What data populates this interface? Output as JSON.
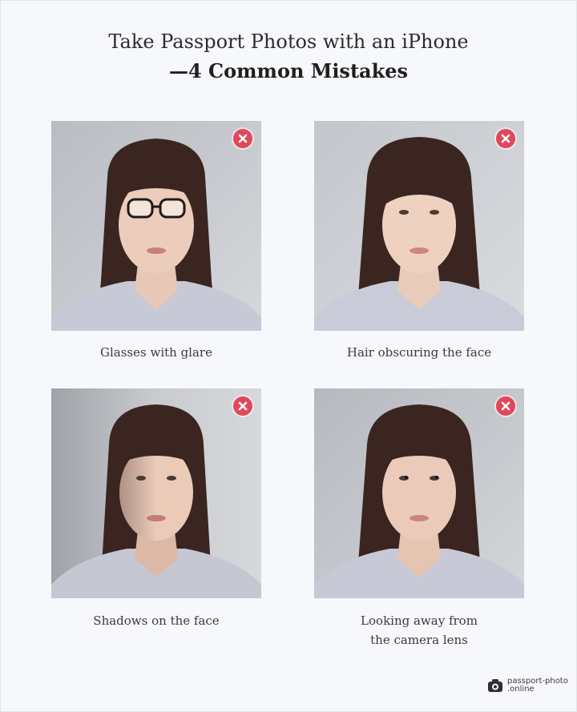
{
  "header": {
    "title_line1": "Take Passport Photos with an iPhone",
    "title_line2": "—4 Common Mistakes"
  },
  "mistakes": [
    {
      "caption_lines": [
        "Glasses with glare"
      ],
      "status_icon": "close-icon",
      "status_color": "#e1475a"
    },
    {
      "caption_lines": [
        "Hair obscuring the face"
      ],
      "status_icon": "close-icon",
      "status_color": "#e1475a"
    },
    {
      "caption_lines": [
        "Shadows on the face"
      ],
      "status_icon": "close-icon",
      "status_color": "#e1475a"
    },
    {
      "caption_lines": [
        "Looking away from",
        "the camera lens"
      ],
      "status_icon": "close-icon",
      "status_color": "#e1475a"
    }
  ],
  "brand": {
    "logo_icon": "camera-icon",
    "name_line1": "passport-photo",
    "name_line2": ".online"
  }
}
